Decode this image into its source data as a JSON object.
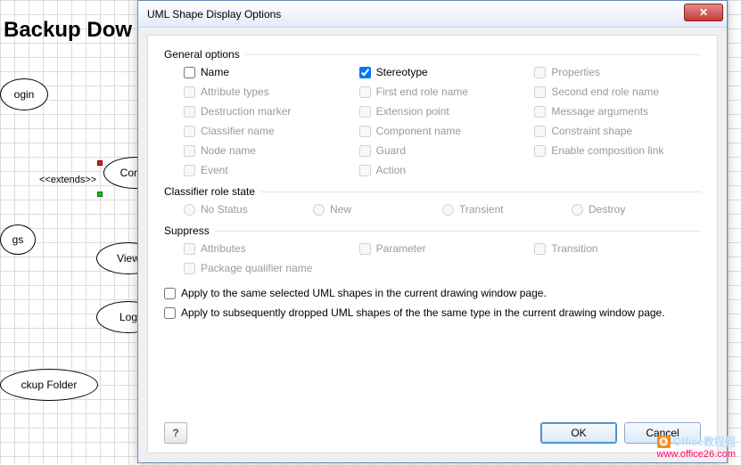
{
  "canvas": {
    "title": "Backup Dow",
    "shapes": {
      "login": "ogin",
      "config": "Config",
      "extends": "<<extends>>",
      "gs": "gs",
      "view": "View",
      "log": "Log",
      "backup_folder": "ckup Folder"
    }
  },
  "dialog": {
    "title": "UML Shape Display Options",
    "close_icon": "✕",
    "groups": {
      "general": {
        "label": "General options",
        "options": [
          {
            "key": "name",
            "label": "Name",
            "checked": false,
            "enabled": true
          },
          {
            "key": "stereotype",
            "label": "Stereotype",
            "checked": true,
            "enabled": true
          },
          {
            "key": "properties",
            "label": "Properties",
            "checked": false,
            "enabled": false
          },
          {
            "key": "attr_types",
            "label": "Attribute types",
            "checked": false,
            "enabled": false
          },
          {
            "key": "first_end",
            "label": "First end role name",
            "checked": false,
            "enabled": false
          },
          {
            "key": "second_end",
            "label": "Second end role name",
            "checked": false,
            "enabled": false
          },
          {
            "key": "destruction",
            "label": "Destruction marker",
            "checked": false,
            "enabled": false
          },
          {
            "key": "extension",
            "label": "Extension point",
            "checked": false,
            "enabled": false
          },
          {
            "key": "message_args",
            "label": "Message arguments",
            "checked": false,
            "enabled": false
          },
          {
            "key": "classifier_name",
            "label": "Classifier name",
            "checked": false,
            "enabled": false
          },
          {
            "key": "component",
            "label": "Component name",
            "checked": false,
            "enabled": false
          },
          {
            "key": "constraint",
            "label": "Constraint shape",
            "checked": false,
            "enabled": false
          },
          {
            "key": "node_name",
            "label": "Node name",
            "checked": false,
            "enabled": false
          },
          {
            "key": "guard",
            "label": "Guard",
            "checked": false,
            "enabled": false
          },
          {
            "key": "enable_comp",
            "label": "Enable composition link",
            "checked": false,
            "enabled": false
          },
          {
            "key": "event",
            "label": "Event",
            "checked": false,
            "enabled": false
          },
          {
            "key": "action",
            "label": "Action",
            "checked": false,
            "enabled": false
          }
        ]
      },
      "classifier": {
        "label": "Classifier role state",
        "options": [
          {
            "key": "nostatus",
            "label": "No Status"
          },
          {
            "key": "new",
            "label": "New"
          },
          {
            "key": "transient",
            "label": "Transient"
          },
          {
            "key": "destroy",
            "label": "Destroy"
          }
        ]
      },
      "suppress": {
        "label": "Suppress",
        "options": [
          {
            "key": "attributes",
            "label": "Attributes",
            "enabled": false
          },
          {
            "key": "parameter",
            "label": "Parameter",
            "enabled": false
          },
          {
            "key": "transition",
            "label": "Transition",
            "enabled": false
          },
          {
            "key": "pkg_qual",
            "label": "Package qualifier name",
            "enabled": false
          }
        ]
      }
    },
    "apply_same": "Apply to the same selected UML shapes in the current drawing window page.",
    "apply_subsequent": "Apply to subsequently dropped UML shapes of the the same type in the current drawing window page.",
    "help_icon": "?",
    "ok": "OK",
    "cancel": "Cancel"
  },
  "watermark": {
    "brand": "Office教程网",
    "url": "www.office26.com"
  }
}
